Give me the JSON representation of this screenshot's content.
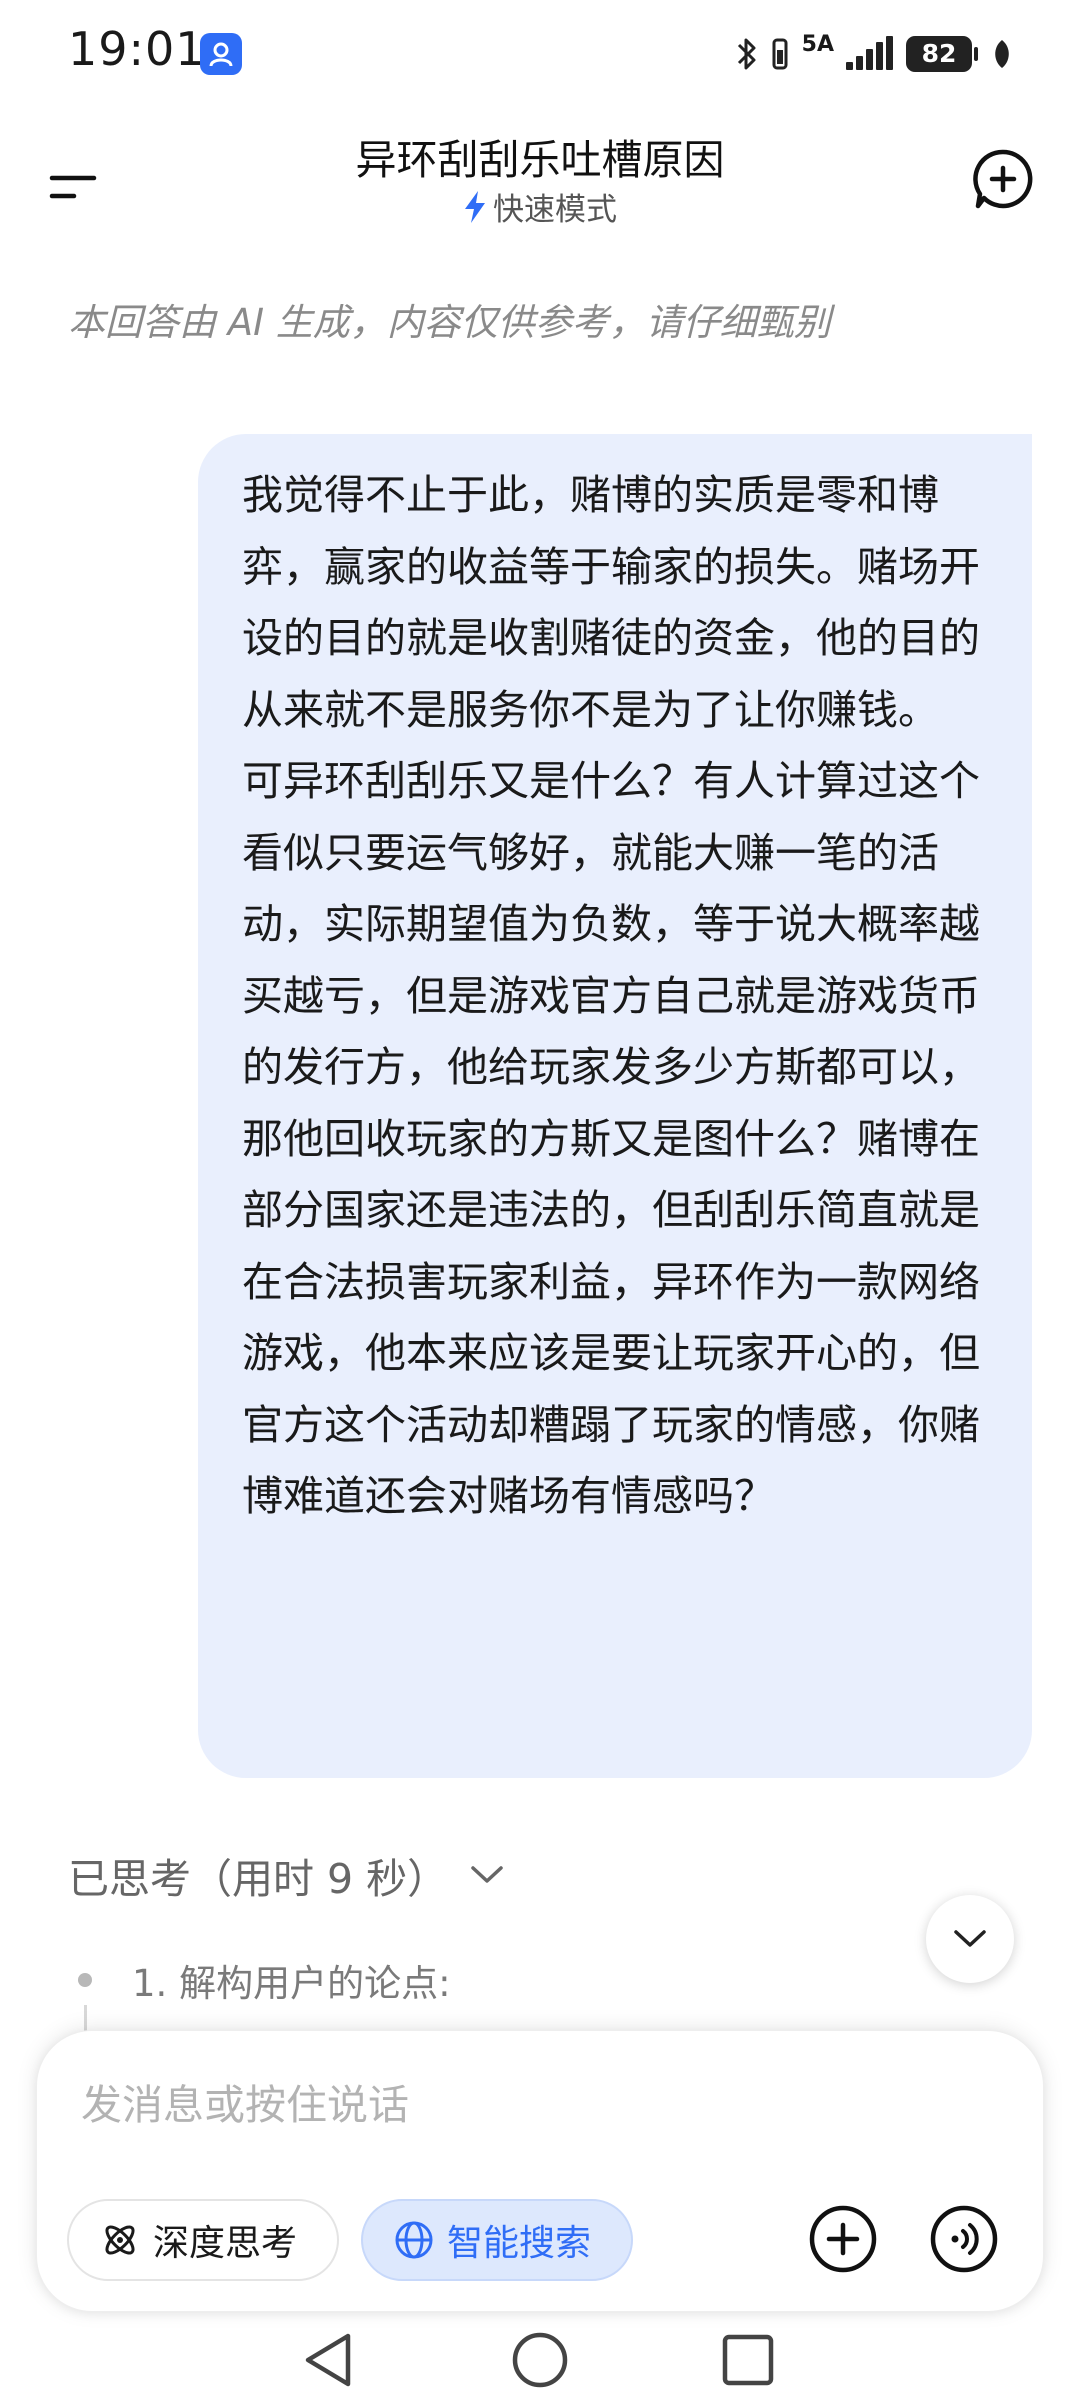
{
  "status_bar": {
    "time": "19:01",
    "network": "5A",
    "battery": "82"
  },
  "header": {
    "title": "异环刮刮乐吐槽原因",
    "mode": "快速模式"
  },
  "disclaimer": "本回答由 AI 生成，内容仅供参考，请仔细甄别",
  "user_message": {
    "text": "我觉得不止于此，赌博的实质是零和博弈，赢家的收益等于输家的损失。赌场开设的目的就是收割赌徒的资金，他的目的从来就不是服务你不是为了让你赚钱。\n可异环刮刮乐又是什么？有人计算过这个看似只要运气够好，就能大赚一笔的活动，实际期望值为负数，等于说大概率越买越亏，但是游戏官方自己就是游戏货币的发行方，他给玩家发多少方斯都可以，那他回收玩家的方斯又是图什么？赌博在部分国家还是违法的，但刮刮乐简直就是在合法损害玩家利益，异环作为一款网络游戏，他本来应该是要让玩家开心的，但官方这个活动却糟蹋了玩家的情感，你赌博难道还会对赌场有情感吗？"
  },
  "thinking": {
    "label": "已思考（用时 9 秒）",
    "step": "1. 解构用户的论点:"
  },
  "composer": {
    "placeholder": "发消息或按住说话",
    "deep_think_label": "深度思考",
    "smart_search_label": "智能搜索"
  },
  "colors": {
    "accent": "#2f6df6",
    "bubble": "#e9effd"
  }
}
